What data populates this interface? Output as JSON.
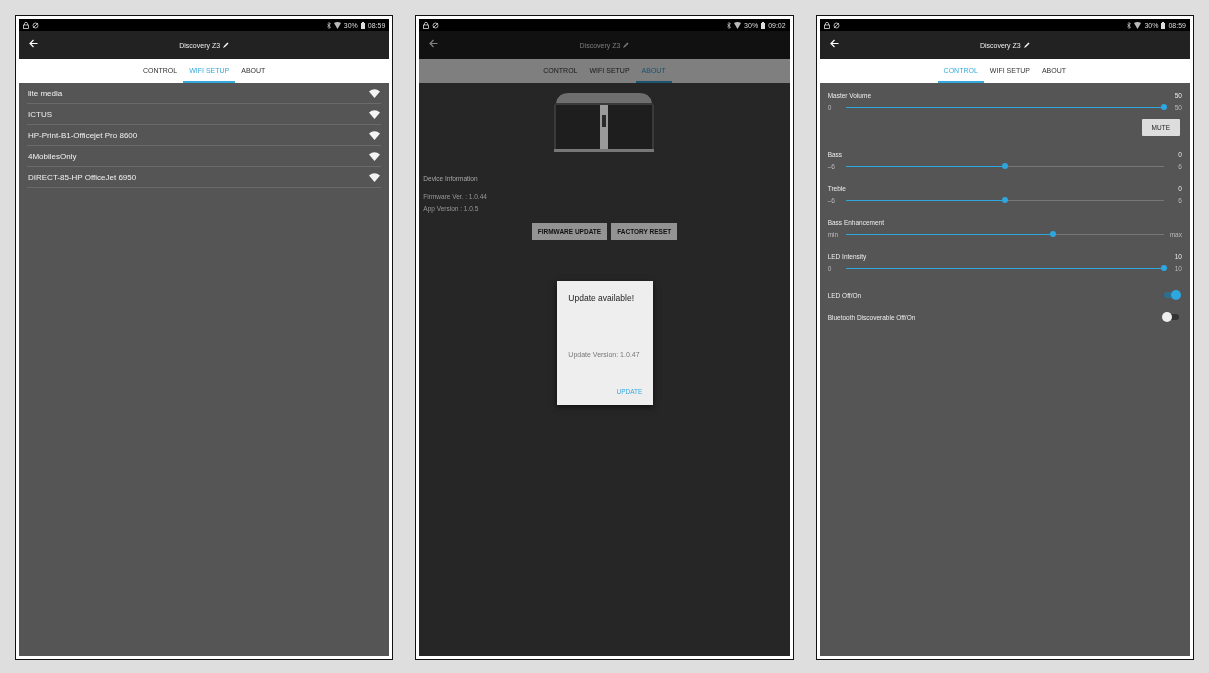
{
  "phones": [
    {
      "kind": "wifi",
      "status": {
        "battery": "30%",
        "time": "08:59"
      },
      "title": "Discovery Z3",
      "tabs": [
        {
          "label": "CONTROL",
          "selected": false
        },
        {
          "label": "WIFI SETUP",
          "selected": true
        },
        {
          "label": "ABOUT",
          "selected": false
        }
      ],
      "networks": [
        {
          "name": "lite media"
        },
        {
          "name": "ICTUS"
        },
        {
          "name": "HP-Print-B1-Officejet Pro 8600"
        },
        {
          "name": "4MobilesOnly"
        },
        {
          "name": "DIRECT-85-HP OfficeJet 6950"
        }
      ]
    },
    {
      "kind": "about",
      "status": {
        "battery": "30%",
        "time": "09:02"
      },
      "title": "Discovery Z3",
      "tabs": [
        {
          "label": "CONTROL",
          "selected": false
        },
        {
          "label": "WIFI SETUP",
          "selected": false
        },
        {
          "label": "ABOUT",
          "selected": true
        }
      ],
      "about": {
        "image": {
          "kind": "picture"
        },
        "heading": "Device Information",
        "lines": [
          "Firmware Ver. : 1.0.44",
          "App Version : 1.0.5"
        ],
        "buttons": [
          "FIRMWARE UPDATE",
          "FACTORY RESET"
        ]
      },
      "dialog": {
        "title": "Update available!",
        "message": "Update Version: 1.0.47",
        "action": "UPDATE"
      }
    },
    {
      "kind": "control",
      "status": {
        "battery": "30%",
        "time": "08:59"
      },
      "title": "Discovery Z3",
      "tabs": [
        {
          "label": "CONTROL",
          "selected": true
        },
        {
          "label": "WIFI SETUP",
          "selected": false
        },
        {
          "label": "ABOUT",
          "selected": false
        }
      ],
      "controls": [
        {
          "kind": "slider",
          "label": "Master Volume",
          "value": "50",
          "min": "0",
          "max": "50",
          "level": 1
        },
        {
          "kind": "button",
          "label": "MUTE"
        },
        {
          "kind": "slider",
          "label": "Bass",
          "value": "0",
          "min": "–6",
          "max": "6",
          "level": 0.5
        },
        {
          "kind": "slider",
          "label": "Treble",
          "value": "0",
          "min": "–6",
          "max": "6",
          "level": 0.5
        },
        {
          "kind": "slider",
          "label": "Bass Enhancement",
          "min": "min",
          "max": "max",
          "level": 0.65
        },
        {
          "kind": "slider",
          "label": "LED Intensity",
          "value": "10",
          "min": "0",
          "max": "10",
          "level": 1
        },
        {
          "kind": "switch",
          "label": "LED Off/On",
          "on": true
        },
        {
          "kind": "switch",
          "label": "Bluetooth Discoverable Off/On",
          "on": false
        }
      ]
    }
  ]
}
